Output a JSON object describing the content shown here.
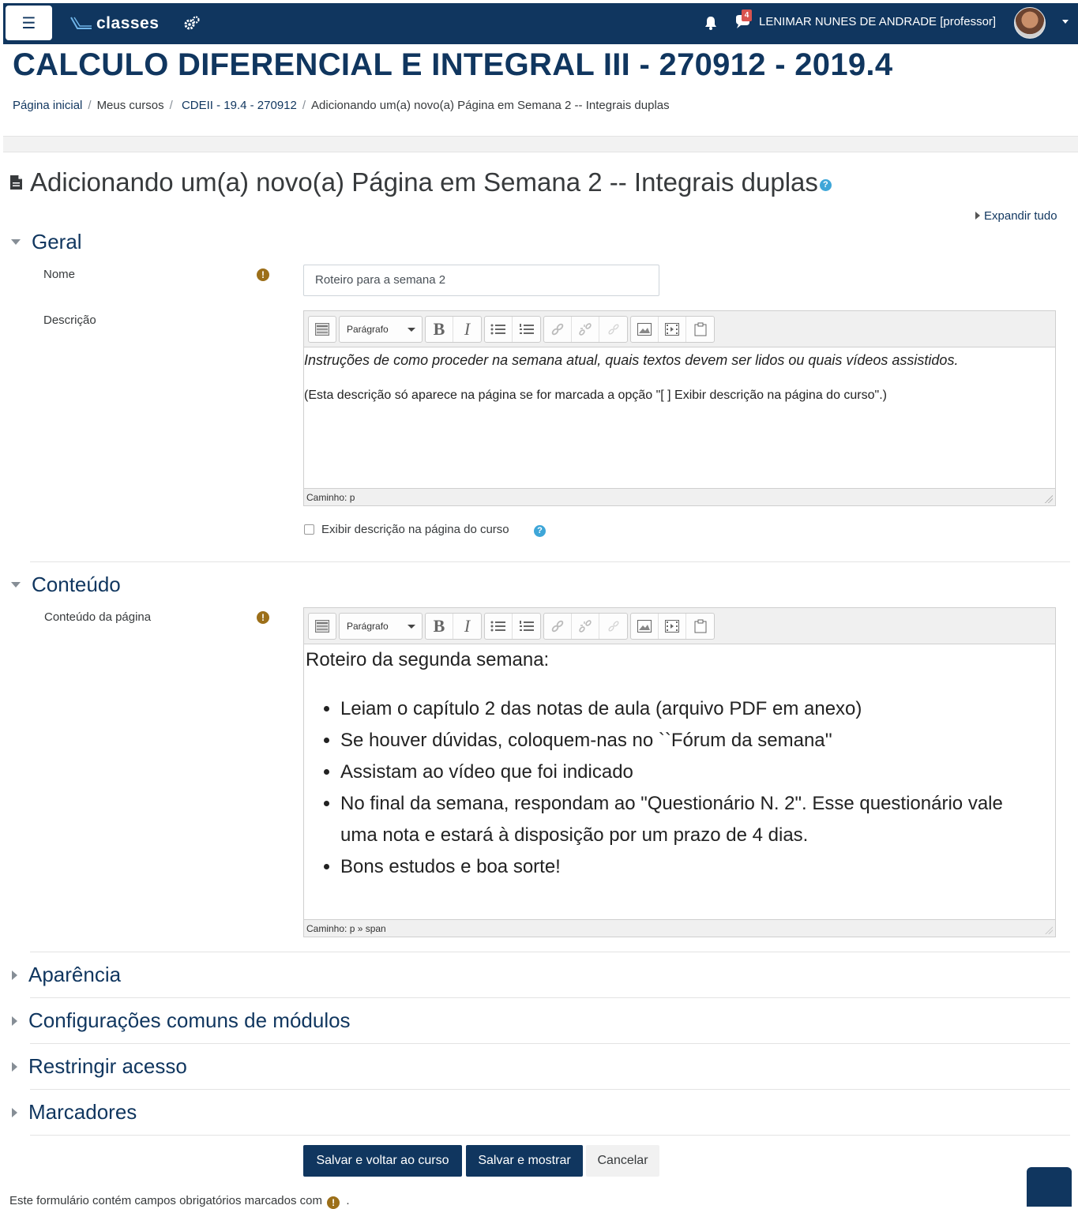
{
  "navbar": {
    "menu_icon": "hamburger-icon",
    "brand": "classes",
    "settings_icon": "gears-icon",
    "notifications_icon": "bell-icon",
    "messages_icon": "chat-icon",
    "messages_count": "4",
    "user_name": "LENIMAR NUNES DE ANDRADE [professor]",
    "accent_color": "#10365f"
  },
  "header": {
    "course_title": "CALCULO DIFERENCIAL E INTEGRAL III - 270912 - 2019.4",
    "breadcrumb": [
      "Página inicial",
      "Meus cursos",
      "CDEII - 19.4 - 270912",
      "Adicionando um(a) novo(a) Página em Semana 2 -- Integrais duplas"
    ]
  },
  "page": {
    "heading": "Adicionando um(a) novo(a) Página em Semana 2 -- Integrais duplas",
    "expand_all": "Expandir tudo"
  },
  "general": {
    "section_title": "Geral",
    "name_label": "Nome",
    "name_value": "Roteiro para a semana 2",
    "description_label": "Descrição",
    "description_line1": "Instruções de como proceder na semana atual, quais textos devem ser lidos ou quais vídeos assistidos.",
    "description_line2": "(Esta descrição só aparece na página se for marcada a opção  \"[  ] Exibir descrição na página do curso\".)",
    "description_path": "Caminho: p",
    "show_description_label": "Exibir descrição na página do curso",
    "show_description_checked": false
  },
  "editor_toolbar": {
    "format_select": "Parágrafo",
    "bold": "B",
    "italic": "I"
  },
  "content": {
    "section_title": "Conteúdo",
    "page_content_label": "Conteúdo da página",
    "intro": "Roteiro da segunda semana:",
    "items": [
      "Leiam o capítulo 2 das notas de aula (arquivo PDF em anexo)",
      "Se houver dúvidas, coloquem-nas no ``Fórum da semana''",
      "Assistam ao vídeo que foi indicado",
      "No final da semana, respondam ao \"Questionário N. 2\". Esse questionário vale uma nota e estará à disposição por um prazo de 4 dias.",
      "Bons estudos e boa sorte!"
    ],
    "path": "Caminho: p » span"
  },
  "collapsed_sections": [
    "Aparência",
    "Configurações comuns de módulos",
    "Restringir acesso",
    "Marcadores"
  ],
  "buttons": {
    "save_return": "Salvar e voltar ao curso",
    "save_display": "Salvar e mostrar",
    "cancel": "Cancelar"
  },
  "footer": {
    "required_note": "Este formulário contém campos obrigatórios marcados com",
    "required_note_end": "."
  }
}
